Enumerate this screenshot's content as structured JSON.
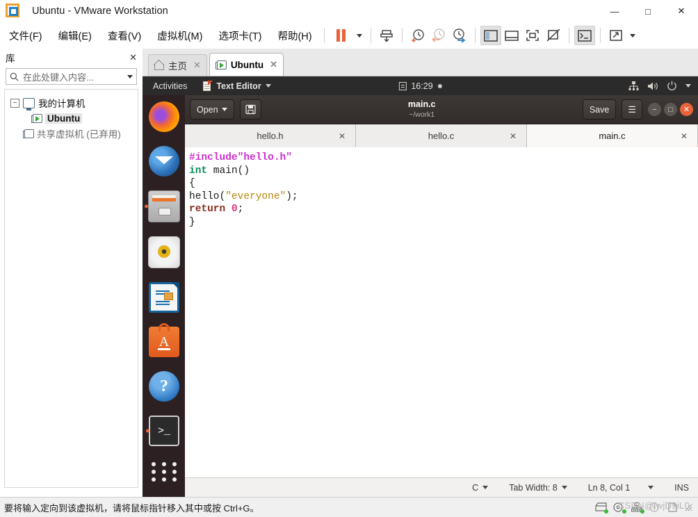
{
  "window": {
    "title": "Ubuntu - VMware Workstation",
    "controls": {
      "minimize": "—",
      "maximize": "□",
      "close": "✕"
    }
  },
  "menubar": {
    "items": [
      {
        "label": "文件(F)",
        "name": "menu-file"
      },
      {
        "label": "编辑(E)",
        "name": "menu-edit"
      },
      {
        "label": "查看(V)",
        "name": "menu-view"
      },
      {
        "label": "虚拟机(M)",
        "name": "menu-vm"
      },
      {
        "label": "选项卡(T)",
        "name": "menu-tabs"
      },
      {
        "label": "帮助(H)",
        "name": "menu-help"
      }
    ]
  },
  "sidebar": {
    "title": "库",
    "close": "✕",
    "search_placeholder": "在此处键入内容...",
    "tree": [
      {
        "label": "我的计算机",
        "expander": "−"
      },
      {
        "label": "Ubuntu",
        "selected": true
      },
      {
        "label": "共享虚拟机 (已弃用)"
      }
    ]
  },
  "vmtabs": [
    {
      "label": "主页",
      "close": "✕",
      "active": false
    },
    {
      "label": "Ubuntu",
      "close": "✕",
      "active": true
    }
  ],
  "gnome": {
    "activities": "Activities",
    "app_menu": "Text Editor",
    "clock": "16:29"
  },
  "dock": [
    {
      "name": "firefox",
      "label": "Firefox"
    },
    {
      "name": "thunderbird",
      "label": "Thunderbird Mail"
    },
    {
      "name": "files",
      "label": "Files"
    },
    {
      "name": "rhythmbox",
      "label": "Rhythmbox"
    },
    {
      "name": "libreoffice-writer",
      "label": "LibreOffice Writer"
    },
    {
      "name": "ubuntu-software",
      "label": "Ubuntu Software"
    },
    {
      "name": "help",
      "label": "Help"
    },
    {
      "name": "terminal",
      "label": "Terminal"
    },
    {
      "name": "show-applications",
      "label": "Show Applications"
    }
  ],
  "gedit": {
    "open_button": "Open",
    "save_button": "Save",
    "menu_button": "☰",
    "title": "main.c",
    "subtitle": "~/work1",
    "tabs": [
      {
        "label": "hello.h",
        "close": "✕",
        "active": false
      },
      {
        "label": "hello.c",
        "close": "✕",
        "active": false
      },
      {
        "label": "main.c",
        "close": "✕",
        "active": true
      }
    ],
    "code_lines": [
      [
        {
          "t": "#include",
          "c": "k-inc"
        },
        {
          "t": "\"hello.h\"",
          "c": "k-inc"
        }
      ],
      [
        {
          "t": "int",
          "c": "k-type"
        },
        {
          "t": " main()",
          "c": "k-pl"
        }
      ],
      [
        {
          "t": "{",
          "c": "k-pl"
        }
      ],
      [
        {
          "t": "hello(",
          "c": "k-pl"
        },
        {
          "t": "\"everyone\"",
          "c": "k-str"
        },
        {
          "t": ");",
          "c": "k-pl"
        }
      ],
      [
        {
          "t": "return",
          "c": "k-ret"
        },
        {
          "t": " ",
          "c": "k-pl"
        },
        {
          "t": "0",
          "c": "k-num"
        },
        {
          "t": ";",
          "c": "k-pl"
        }
      ],
      [
        {
          "t": "}",
          "c": "k-pl"
        }
      ]
    ],
    "status": {
      "language": "C",
      "tab_width": "Tab Width: 8",
      "position": "Ln 8, Col 1",
      "insert_mode": "INS"
    }
  },
  "statusbar": {
    "message": "要将输入定向到该虚拟机，请将鼠标指针移入其中或按 Ctrl+G。",
    "watermark": "CSDN@iwjD9iL0"
  },
  "colors": {
    "accent_orange": "#e8623a",
    "ubuntu_bg": "#2c2022",
    "gnome_bar": "#2b2b2b",
    "gedit_header": "#3a3431"
  }
}
